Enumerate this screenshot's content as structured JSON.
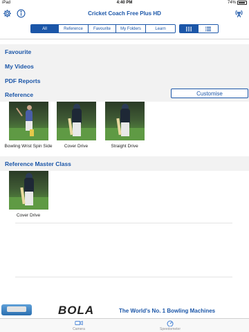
{
  "status_bar": {
    "device": "iPad",
    "time": "4:40 PM",
    "battery": "74%"
  },
  "nav": {
    "title": "Cricket Coach Free Plus HD",
    "settings_icon": "gear-icon",
    "info_icon": "info-icon",
    "broadcast_icon": "broadcast-icon"
  },
  "filter_tabs": [
    "All",
    "Reference",
    "Favourite",
    "My Folders",
    "Learn"
  ],
  "active_filter": "All",
  "view_toggle": {
    "grid_icon": "grid-icon",
    "list_icon": "list-icon",
    "active": "grid"
  },
  "sections": {
    "favourite": "Favourite",
    "my_videos": "My Videos",
    "pdf_reports": "PDF Reports",
    "reference": "Reference",
    "customise": "Customise",
    "master_class": "Reference Master Class"
  },
  "reference_items": [
    {
      "label": "Bowling Wrist Spin Side"
    },
    {
      "label": "Cover Drive"
    },
    {
      "label": "Straight Drive"
    }
  ],
  "master_class_items": [
    {
      "label": "Cover Drive"
    }
  ],
  "ad": {
    "logo": "BOLA",
    "text": "The World's No. 1 Bowling Machines"
  },
  "tab_bar": [
    {
      "label": "Camera",
      "icon": "video-camera-icon"
    },
    {
      "label": "Speedometer",
      "icon": "speedometer-icon"
    }
  ],
  "colors": {
    "accent": "#1b56a8",
    "shade": "#f2f2f2"
  }
}
